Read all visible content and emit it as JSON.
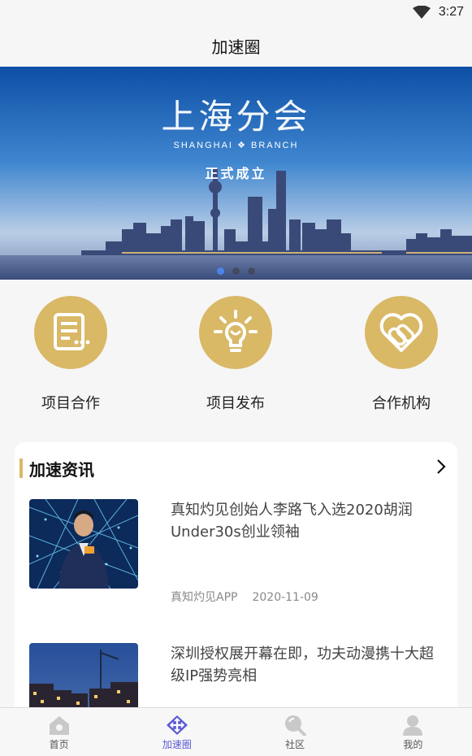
{
  "status_bar": {
    "time": "3:27"
  },
  "header": {
    "title": "加速圈"
  },
  "banner": {
    "title": "上海分会",
    "subtitle_left": "SHANGHAI",
    "subtitle_right": "BRANCH",
    "slogan": "正式成立",
    "slide_count": 3,
    "active_slide": 1
  },
  "quick_actions": [
    {
      "label": "项目合作",
      "icon": "document-icon"
    },
    {
      "label": "项目发布",
      "icon": "lightbulb-icon"
    },
    {
      "label": "合作机构",
      "icon": "handshake-heart-icon"
    }
  ],
  "news": {
    "section_title": "加速资讯",
    "items": [
      {
        "title": "真知灼见创始人李路飞入选2020胡润Under30s创业领袖",
        "source": "真知灼见APP",
        "date": "2020-11-09"
      },
      {
        "title": "深圳授权展开幕在即，功夫动漫携十大超级IP强势亮相",
        "source": "",
        "date": ""
      }
    ]
  },
  "tabbar": {
    "items": [
      {
        "label": "首页",
        "icon": "home-icon"
      },
      {
        "label": "加速圈",
        "icon": "accelerate-icon",
        "active": true
      },
      {
        "label": "社区",
        "icon": "community-search-icon"
      },
      {
        "label": "我的",
        "icon": "profile-icon"
      }
    ]
  },
  "colors": {
    "accent_gold": "#d9b866",
    "tab_active": "#5b5bd6",
    "dot_active": "#4a86e8"
  }
}
